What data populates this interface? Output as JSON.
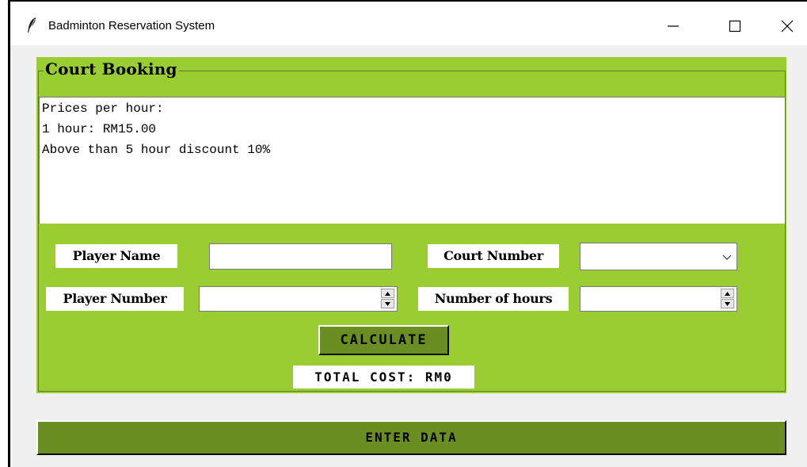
{
  "window": {
    "title": "Badminton Reservation System"
  },
  "frame": {
    "title": "Court Booking"
  },
  "info": {
    "lines": [
      "Prices per hour:",
      "1 hour: RM15.00",
      "Above than 5 hour discount 10%"
    ]
  },
  "form": {
    "player_name_label": "Player Name",
    "player_name_value": "",
    "court_number_label": "Court Number",
    "court_number_value": "",
    "player_number_label": "Player Number",
    "player_number_value": "",
    "hours_label": "Number of hours",
    "hours_value": ""
  },
  "actions": {
    "calculate_label": "CALCULATE",
    "total_cost": "TOTAL COST: RM0",
    "enter_label": "ENTER DATA"
  },
  "colors": {
    "frame_bg": "#9acd32",
    "button_bg": "#6b8e23"
  }
}
